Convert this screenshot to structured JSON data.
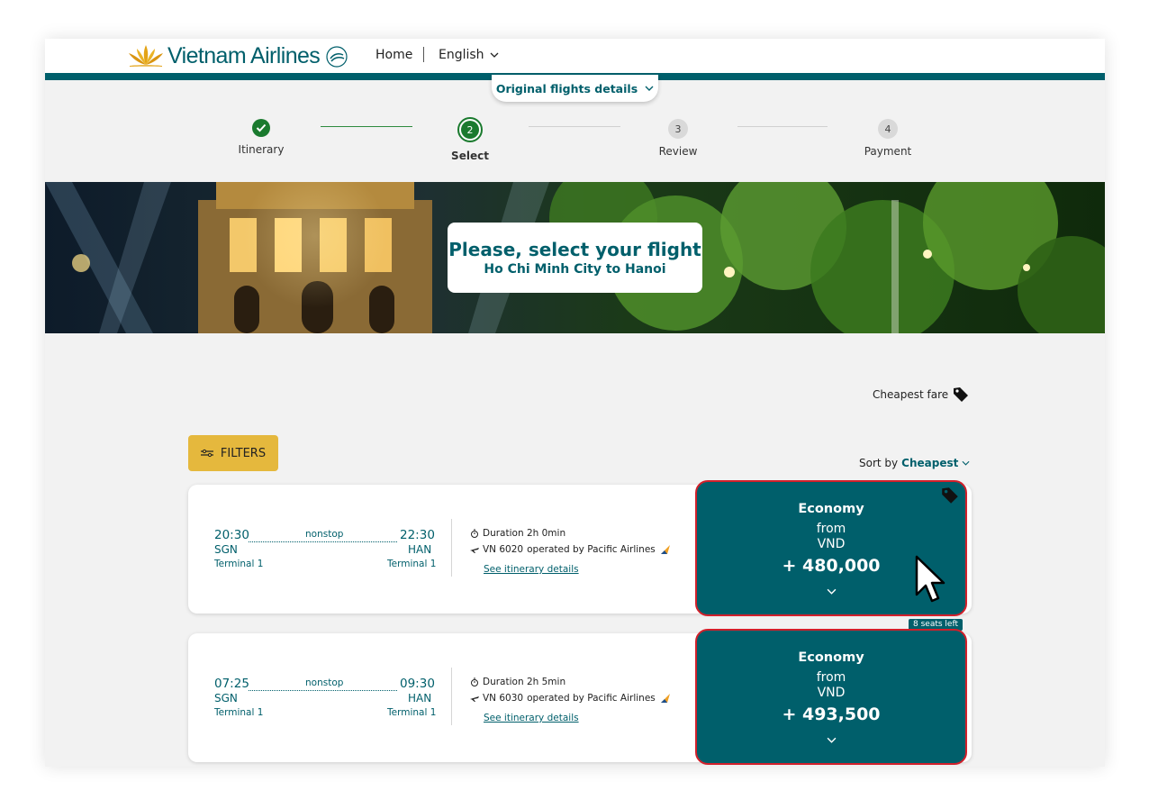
{
  "header": {
    "logo_text": "Vietnam Airlines",
    "nav_home": "Home",
    "nav_language": "English"
  },
  "original_flights": {
    "label": "Original flights details"
  },
  "steps": [
    {
      "number": "",
      "label": "Itinerary",
      "status": "completed"
    },
    {
      "number": "2",
      "label": "Select",
      "status": "active"
    },
    {
      "number": "3",
      "label": "Review",
      "status": "pending"
    },
    {
      "number": "4",
      "label": "Payment",
      "status": "pending"
    }
  ],
  "banner": {
    "title": "Please, select your flight",
    "subtitle": "Ho Chi Minh City to Hanoi"
  },
  "cheapest_fare": {
    "label": "Cheapest fare"
  },
  "filters": {
    "label": "FILTERS"
  },
  "sort": {
    "prefix": "Sort by",
    "value": "Cheapest"
  },
  "flights": [
    {
      "depart_time": "20:30",
      "arrive_time": "22:30",
      "stops": "nonstop",
      "origin": "SGN",
      "destination": "HAN",
      "origin_terminal": "Terminal 1",
      "destination_terminal": "Terminal 1",
      "duration": "Duration 2h 0min",
      "flight_number": "VN 6020",
      "operated_by": "operated by Pacific Airlines",
      "details_link": "See itinerary details",
      "fare": {
        "cabin": "Economy",
        "from": "from",
        "currency": "VND",
        "price": "+ 480,000",
        "cheapest_tag": true
      },
      "seats_left": "8 seats left"
    },
    {
      "depart_time": "07:25",
      "arrive_time": "09:30",
      "stops": "nonstop",
      "origin": "SGN",
      "destination": "HAN",
      "origin_terminal": "Terminal 1",
      "destination_terminal": "Terminal 1",
      "duration": "Duration 2h 5min",
      "flight_number": "VN 6030",
      "operated_by": "operated by Pacific Airlines",
      "details_link": "See itinerary details",
      "fare": {
        "cabin": "Economy",
        "from": "from",
        "currency": "VND",
        "price": "+ 493,500",
        "cheapest_tag": false
      }
    }
  ],
  "colors": {
    "brand_teal": "#005f6b",
    "accent_gold": "#e5b83d",
    "fare_border": "#d2202b",
    "step_complete": "#1a7a2e"
  }
}
